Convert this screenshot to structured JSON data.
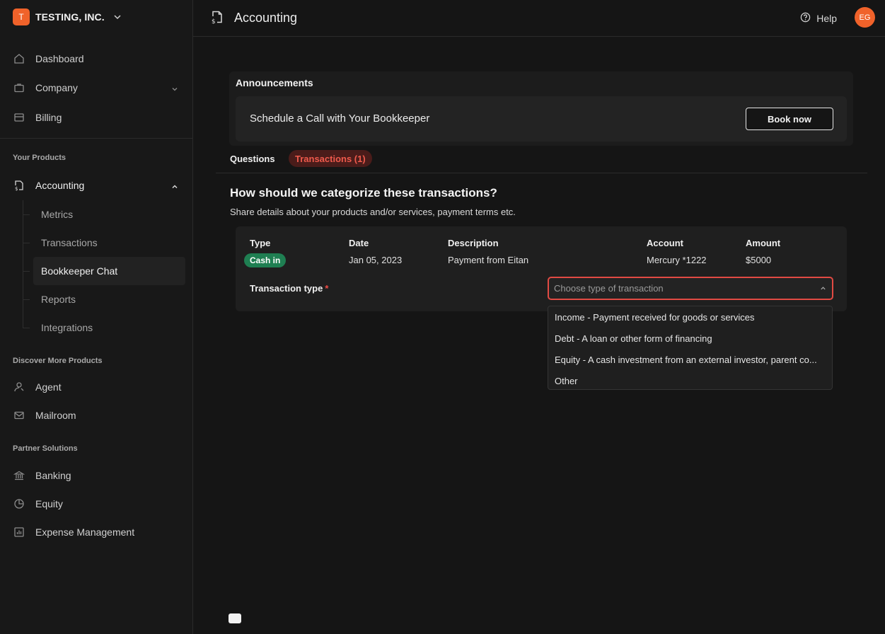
{
  "org": {
    "initial": "T",
    "name": "TESTING, INC."
  },
  "sidebar": {
    "main_items": [
      {
        "label": "Dashboard",
        "icon": "home-icon"
      },
      {
        "label": "Company",
        "icon": "briefcase-icon"
      },
      {
        "label": "Billing",
        "icon": "billing-icon"
      }
    ],
    "your_products_label": "Your Products",
    "accounting": {
      "label": "Accounting",
      "icon": "accounting-icon"
    },
    "accounting_sub": [
      "Metrics",
      "Transactions",
      "Bookkeeper Chat",
      "Reports",
      "Integrations"
    ],
    "discover_label": "Discover More Products",
    "discover_items": [
      {
        "label": "Agent",
        "icon": "agent-icon"
      },
      {
        "label": "Mailroom",
        "icon": "mail-icon"
      }
    ],
    "partner_label": "Partner Solutions",
    "partner_items": [
      {
        "label": "Banking",
        "icon": "bank-icon"
      },
      {
        "label": "Equity",
        "icon": "pie-chart-icon"
      },
      {
        "label": "Expense Management",
        "icon": "bar-chart-icon"
      }
    ]
  },
  "header": {
    "title": "Accounting",
    "help_label": "Help",
    "avatar_initials": "EG"
  },
  "announcements": {
    "title": "Announcements",
    "text": "Schedule a Call with Your Bookkeeper",
    "button": "Book now"
  },
  "tabs": {
    "questions": "Questions",
    "transactions": "Transactions (1)"
  },
  "question": {
    "title": "How should we categorize these transactions?",
    "subtitle": "Share details about your products and/or services, payment terms etc."
  },
  "transaction": {
    "headers": {
      "type": "Type",
      "date": "Date",
      "description": "Description",
      "account": "Account",
      "amount": "Amount"
    },
    "type": "Cash in",
    "date": "Jan 05, 2023",
    "description": "Payment from Eitan",
    "account": "Mercury *1222",
    "amount": "$5000",
    "type_label": "Transaction type",
    "required_mark": "*",
    "select_placeholder": "Choose type of transaction",
    "options": [
      "Income - Payment received for goods or services",
      "Debt - A loan or other form of financing",
      "Equity - A cash investment from an external investor, parent co...",
      "Other"
    ]
  },
  "colors": {
    "accent": "#f0622a",
    "error": "#e14a43",
    "success_badge": "#1f7f52",
    "background": "#151515"
  }
}
